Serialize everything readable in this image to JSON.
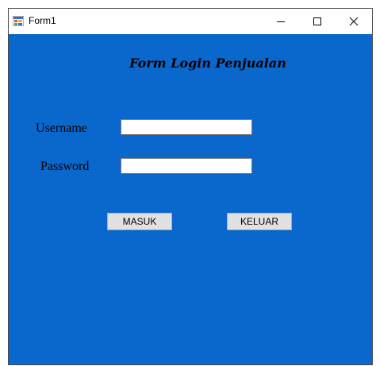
{
  "window": {
    "title": "Form1",
    "icon": "winforms-app-icon",
    "controls": {
      "minimize_icon": "minimize-icon",
      "maximize_icon": "maximize-icon",
      "close_icon": "close-icon"
    }
  },
  "form": {
    "title": "Form Login Penjualan",
    "username_label": "Username",
    "password_label": "Password",
    "username_value": "",
    "password_value": "",
    "masuk_label": "MASUK",
    "keluar_label": "KELUAR"
  },
  "colors": {
    "client_background": "#0a67cc",
    "button_face": "#e1e1e1"
  }
}
